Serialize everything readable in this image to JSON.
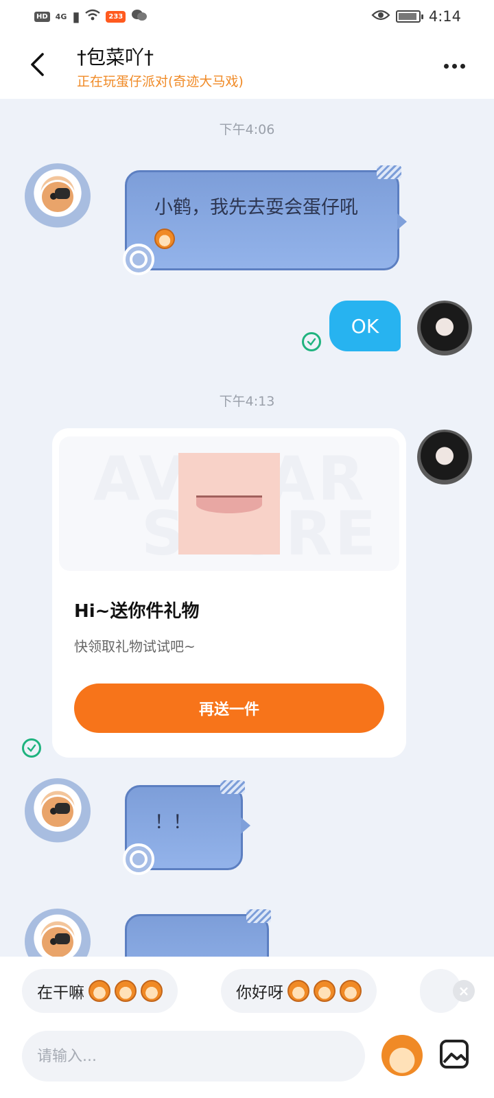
{
  "status_bar": {
    "left_badge": "HD",
    "network": "4G",
    "app_badge": "233",
    "time": "4:14"
  },
  "header": {
    "title": "†包菜吖†",
    "subtitle": "正在玩蛋仔派对(奇迹大马戏)"
  },
  "chat": {
    "timestamp_1": "下午4:06",
    "msg_1": "小鹤，我先去耍会蛋仔吼",
    "msg_2": "OK",
    "timestamp_2": "下午4:13",
    "gift": {
      "watermark_1": "AVATAR",
      "watermark_2": "STORE",
      "title": "Hi~送你件礼物",
      "description": "快领取礼物试试吧~",
      "button_label": "再送一件"
    },
    "msg_3": "！！"
  },
  "quick_replies": [
    {
      "label": "在干嘛"
    },
    {
      "label": "你好呀"
    }
  ],
  "input": {
    "placeholder": "请输入..."
  },
  "colors": {
    "accent_orange": "#f7741a",
    "sent_bubble": "#27b3f0",
    "status_online": "#f08a26",
    "read_check": "#1fb37f"
  },
  "icons": [
    "back-arrow-icon",
    "more-dots-icon",
    "read-check-icon",
    "close-icon",
    "emoji-icon",
    "image-icon",
    "eye-icon",
    "battery-icon",
    "wifi-icon"
  ]
}
